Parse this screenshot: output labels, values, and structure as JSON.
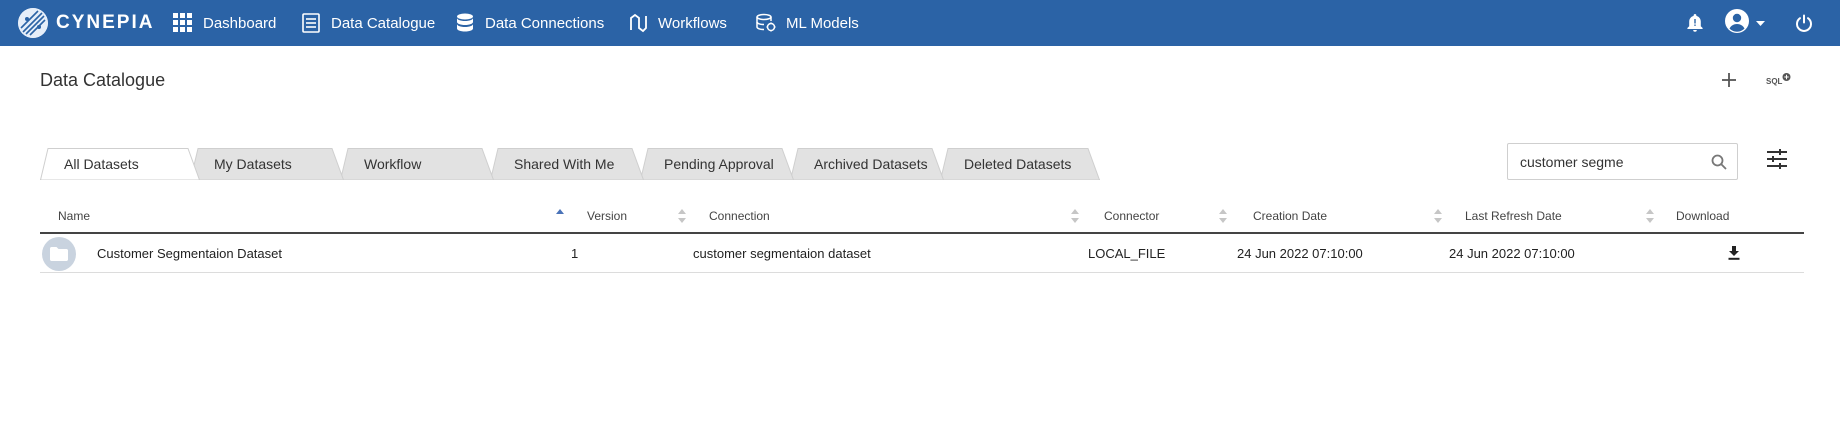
{
  "app": {
    "brand": "CYNEPIA"
  },
  "nav": {
    "items": [
      {
        "label": "Dashboard",
        "icon": "grid-icon"
      },
      {
        "label": "Data Catalogue",
        "icon": "catalogue-icon"
      },
      {
        "label": "Data Connections",
        "icon": "database-icon"
      },
      {
        "label": "Workflows",
        "icon": "workflow-icon"
      },
      {
        "label": "ML Models",
        "icon": "ml-models-icon"
      }
    ],
    "right_icons": [
      "bell-icon",
      "user-icon",
      "power-icon"
    ]
  },
  "page": {
    "title": "Data Catalogue"
  },
  "header_actions": [
    "add-icon",
    "sql-icon"
  ],
  "tabs": [
    {
      "label": "All Datasets",
      "active": true
    },
    {
      "label": "My Datasets",
      "active": false
    },
    {
      "label": "Workflow",
      "active": false
    },
    {
      "label": "Shared With Me",
      "active": false
    },
    {
      "label": "Pending Approval",
      "active": false
    },
    {
      "label": "Archived Datasets",
      "active": false
    },
    {
      "label": "Deleted Datasets",
      "active": false
    }
  ],
  "search": {
    "value": "customer segme",
    "placeholder": ""
  },
  "table": {
    "columns": [
      "Name",
      "Version",
      "Connection",
      "Connector",
      "Creation Date",
      "Last Refresh Date",
      "Download"
    ],
    "rows": [
      {
        "name": "Customer Segmentaion Dataset",
        "version": "1",
        "connection": "customer segmentaion dataset",
        "connector": "LOCAL_FILE",
        "creation_date": "24 Jun 2022 07:10:00",
        "last_refresh_date": "24 Jun 2022 07:10:00"
      }
    ]
  },
  "colors": {
    "topbar": "#2b63a6",
    "tab_inactive": "#e2e2e2",
    "tab_active": "#ffffff",
    "sort_active": "#4a73b8"
  }
}
